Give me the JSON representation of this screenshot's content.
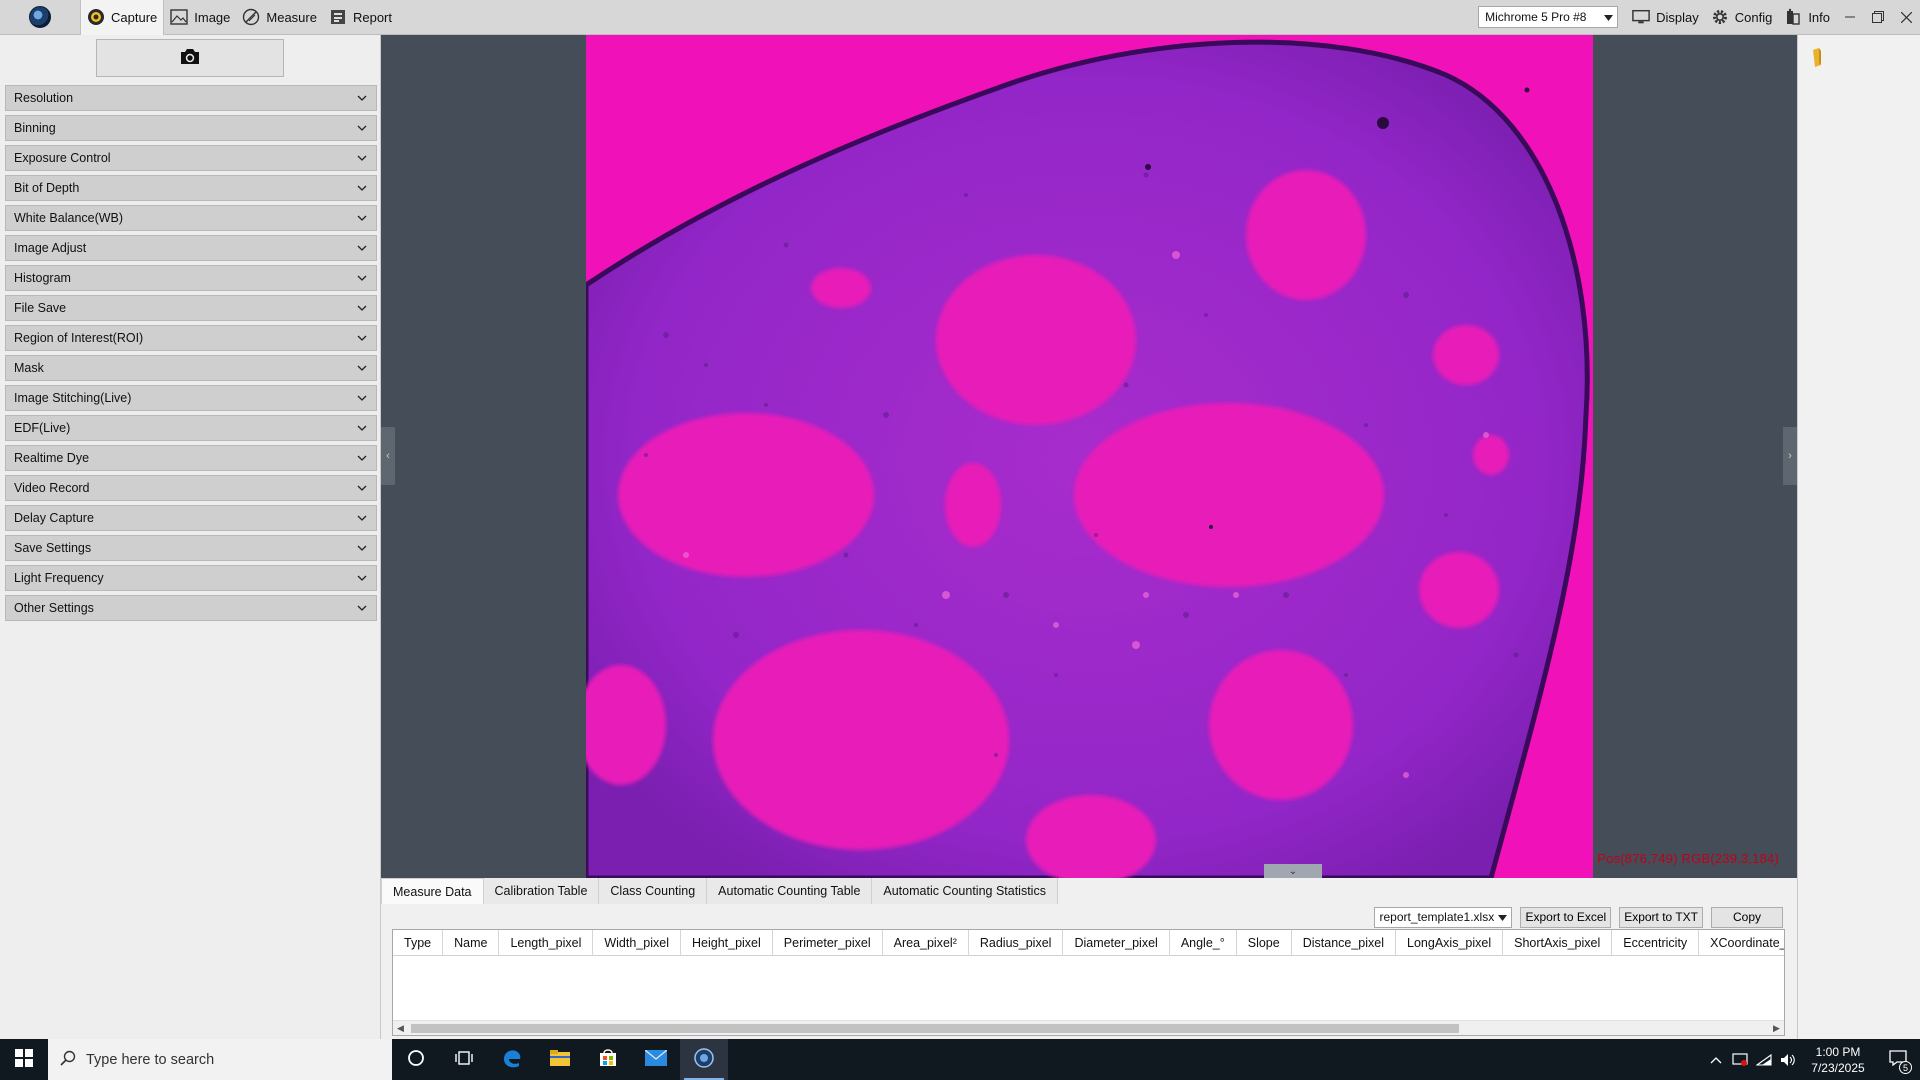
{
  "topbar": {
    "tabs": [
      {
        "label": "Capture",
        "icon": "capture-icon",
        "active": true
      },
      {
        "label": "Image",
        "icon": "image-icon",
        "active": false
      },
      {
        "label": "Measure",
        "icon": "measure-icon",
        "active": false
      },
      {
        "label": "Report",
        "icon": "report-icon",
        "active": false
      }
    ],
    "camera_select": "Michrome 5 Pro #8",
    "right_items": [
      {
        "label": "Display",
        "icon": "display-icon"
      },
      {
        "label": "Config",
        "icon": "gear-icon"
      },
      {
        "label": "Info",
        "icon": "info-icon"
      }
    ]
  },
  "left_panel": {
    "sections": [
      "Resolution",
      "Binning",
      "Exposure Control",
      "Bit of Depth",
      "White Balance(WB)",
      "Image Adjust",
      "Histogram",
      "File Save",
      "Region of Interest(ROI)",
      "Mask",
      "Image Stitching(Live)",
      "EDF(Live)",
      "Realtime Dye",
      "Video Record",
      "Delay Capture",
      "Save Settings",
      "Light Frequency",
      "Other Settings"
    ]
  },
  "viewer": {
    "pixel_readout": "Pos(876,749) RGB(239,3,184)"
  },
  "bottom": {
    "tabs": [
      {
        "label": "Measure Data",
        "active": true
      },
      {
        "label": "Calibration Table",
        "active": false
      },
      {
        "label": "Class Counting",
        "active": false
      },
      {
        "label": "Automatic Counting Table",
        "active": false
      },
      {
        "label": "Automatic Counting Statistics",
        "active": false
      }
    ],
    "template_select": "report_template1.xlsx",
    "export_excel": "Export to Excel",
    "export_txt": "Export to TXT",
    "copy": "Copy",
    "columns": [
      "Type",
      "Name",
      "Length_pixel",
      "Width_pixel",
      "Height_pixel",
      "Perimeter_pixel",
      "Area_pixel²",
      "Radius_pixel",
      "Diameter_pixel",
      "Angle_°",
      "Slope",
      "Distance_pixel",
      "LongAxis_pixel",
      "ShortAxis_pixel",
      "Eccentricity",
      "XCoordinate_pixel"
    ]
  },
  "taskbar": {
    "search_placeholder": "Type here to search",
    "time": "1:00 PM",
    "date": "7/23/2025",
    "notification_count": "5"
  }
}
